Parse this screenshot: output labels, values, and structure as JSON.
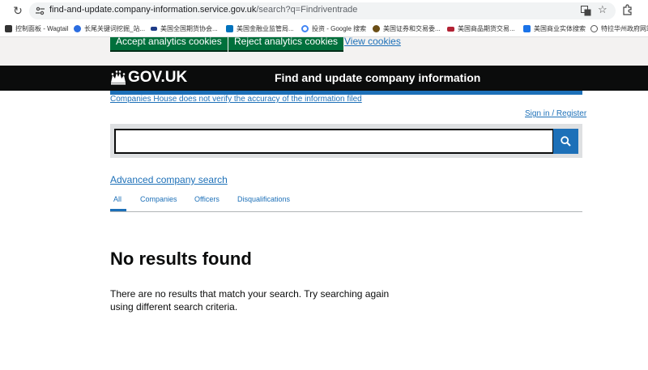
{
  "browser": {
    "url_host": "find-and-update.company-information.service.gov.uk",
    "url_path": "/search?q=Findriventrade",
    "bookmarks": [
      {
        "label": "控制面板 - Wagtail",
        "color": "#333333"
      },
      {
        "label": "长尾关键词挖掘_站...",
        "color": "#2b6de0"
      },
      {
        "label": "美国全国期货协会...",
        "color": "#1f3c88"
      },
      {
        "label": "美国金融业监管局...",
        "color": "#0072bc"
      },
      {
        "label": "投资 - Google 搜索",
        "color": "#4285f4"
      },
      {
        "label": "美国证券和交易委...",
        "color": "#6b4e16"
      },
      {
        "label": "美国商品期货交易...",
        "color": "#b22234"
      },
      {
        "label": "美国商业实体搜索",
        "color": "#1a73e8"
      },
      {
        "label": "特拉华州政府网站",
        "color": "#555555"
      }
    ]
  },
  "cookies": {
    "accept_label": "Accept analytics cookies",
    "reject_label": "Reject analytics cookies",
    "view_label": "View cookies"
  },
  "header": {
    "logo_text": "GOV.UK",
    "service_name": "Find and update company information"
  },
  "phase_banner": {
    "link_text": "Companies House does not verify the accuracy of the information filed"
  },
  "account": {
    "sign_in_label": "Sign in / Register"
  },
  "search": {
    "value": "",
    "placeholder": ""
  },
  "advanced_search_label": "Advanced company search",
  "tabs": [
    {
      "label": "All",
      "active": true
    },
    {
      "label": "Companies",
      "active": false
    },
    {
      "label": "Officers",
      "active": false
    },
    {
      "label": "Disqualifications",
      "active": false
    }
  ],
  "results": {
    "heading": "No results found",
    "message": "There are no results that match your search. Try searching again using different search criteria."
  },
  "colors": {
    "link": "#1d70b8",
    "header_bg": "#0b0c0c",
    "cookie_button": "#00703c"
  }
}
